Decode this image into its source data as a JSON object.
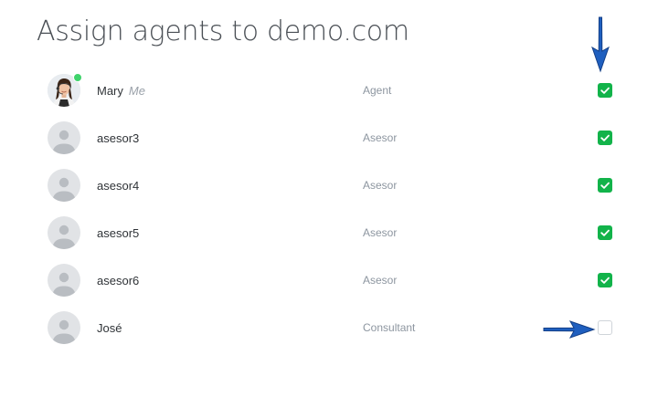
{
  "page": {
    "title": "Assign agents to demo.com"
  },
  "agents": [
    {
      "name": "Mary",
      "me_label": "Me",
      "role": "Agent",
      "assigned": true,
      "online": true,
      "avatar": "photo"
    },
    {
      "name": "asesor3",
      "role": "Asesor",
      "assigned": true,
      "avatar": "placeholder"
    },
    {
      "name": "asesor4",
      "role": "Asesor",
      "assigned": true,
      "avatar": "placeholder"
    },
    {
      "name": "asesor5",
      "role": "Asesor",
      "assigned": true,
      "avatar": "placeholder"
    },
    {
      "name": "asesor6",
      "role": "Asesor",
      "assigned": true,
      "avatar": "placeholder"
    },
    {
      "name": "José",
      "role": "Consultant",
      "assigned": false,
      "avatar": "placeholder"
    }
  ],
  "colors": {
    "checked": "#12b34a",
    "online": "#3fd36b",
    "annotation_arrow": "#1f5fbf"
  },
  "annotations": [
    {
      "icon": "arrow-down-icon",
      "target": "Mary"
    },
    {
      "icon": "arrow-right-icon",
      "target": "José"
    }
  ]
}
